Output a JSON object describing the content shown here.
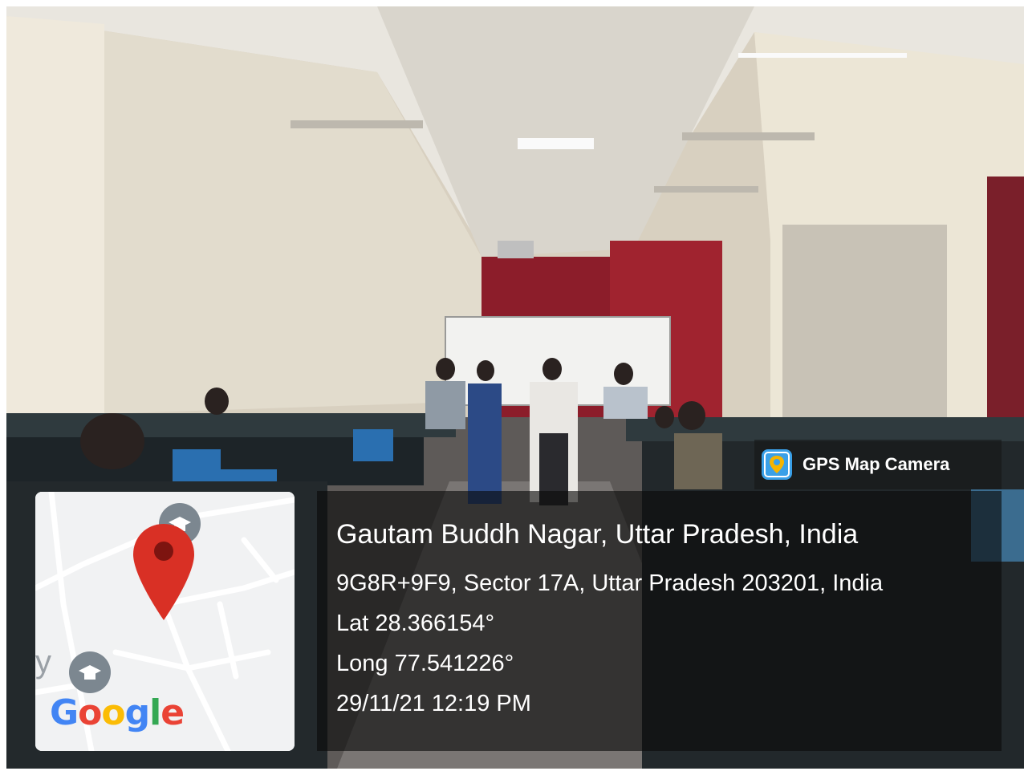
{
  "badge": {
    "app_name": "GPS Map Camera",
    "icon": "gps-map-camera-icon"
  },
  "location": {
    "title": "Gautam Buddh Nagar, Uttar Pradesh, India",
    "address": "9G8R+9F9, Sector 17A, Uttar Pradesh 203201, India",
    "lat": "Lat 28.366154°",
    "long": "Long 77.541226°",
    "datetime": "29/11/21 12:19 PM"
  },
  "map": {
    "brand": "Google",
    "partial_label": "y",
    "pin_color": "#d93025",
    "marker_icons": [
      "graduation-cap-icon",
      "graduation-cap-icon"
    ]
  }
}
